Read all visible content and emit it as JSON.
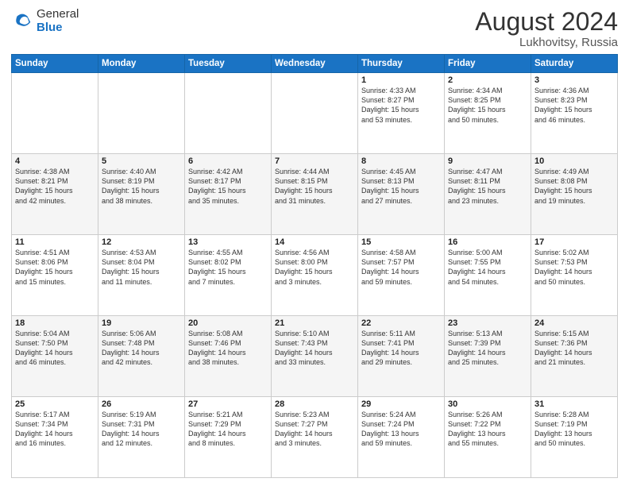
{
  "header": {
    "logo_general": "General",
    "logo_blue": "Blue",
    "month_title": "August 2024",
    "location": "Lukhovitsy, Russia"
  },
  "days_of_week": [
    "Sunday",
    "Monday",
    "Tuesday",
    "Wednesday",
    "Thursday",
    "Friday",
    "Saturday"
  ],
  "weeks": [
    [
      {
        "day": "",
        "detail": ""
      },
      {
        "day": "",
        "detail": ""
      },
      {
        "day": "",
        "detail": ""
      },
      {
        "day": "",
        "detail": ""
      },
      {
        "day": "1",
        "detail": "Sunrise: 4:33 AM\nSunset: 8:27 PM\nDaylight: 15 hours\nand 53 minutes."
      },
      {
        "day": "2",
        "detail": "Sunrise: 4:34 AM\nSunset: 8:25 PM\nDaylight: 15 hours\nand 50 minutes."
      },
      {
        "day": "3",
        "detail": "Sunrise: 4:36 AM\nSunset: 8:23 PM\nDaylight: 15 hours\nand 46 minutes."
      }
    ],
    [
      {
        "day": "4",
        "detail": "Sunrise: 4:38 AM\nSunset: 8:21 PM\nDaylight: 15 hours\nand 42 minutes."
      },
      {
        "day": "5",
        "detail": "Sunrise: 4:40 AM\nSunset: 8:19 PM\nDaylight: 15 hours\nand 38 minutes."
      },
      {
        "day": "6",
        "detail": "Sunrise: 4:42 AM\nSunset: 8:17 PM\nDaylight: 15 hours\nand 35 minutes."
      },
      {
        "day": "7",
        "detail": "Sunrise: 4:44 AM\nSunset: 8:15 PM\nDaylight: 15 hours\nand 31 minutes."
      },
      {
        "day": "8",
        "detail": "Sunrise: 4:45 AM\nSunset: 8:13 PM\nDaylight: 15 hours\nand 27 minutes."
      },
      {
        "day": "9",
        "detail": "Sunrise: 4:47 AM\nSunset: 8:11 PM\nDaylight: 15 hours\nand 23 minutes."
      },
      {
        "day": "10",
        "detail": "Sunrise: 4:49 AM\nSunset: 8:08 PM\nDaylight: 15 hours\nand 19 minutes."
      }
    ],
    [
      {
        "day": "11",
        "detail": "Sunrise: 4:51 AM\nSunset: 8:06 PM\nDaylight: 15 hours\nand 15 minutes."
      },
      {
        "day": "12",
        "detail": "Sunrise: 4:53 AM\nSunset: 8:04 PM\nDaylight: 15 hours\nand 11 minutes."
      },
      {
        "day": "13",
        "detail": "Sunrise: 4:55 AM\nSunset: 8:02 PM\nDaylight: 15 hours\nand 7 minutes."
      },
      {
        "day": "14",
        "detail": "Sunrise: 4:56 AM\nSunset: 8:00 PM\nDaylight: 15 hours\nand 3 minutes."
      },
      {
        "day": "15",
        "detail": "Sunrise: 4:58 AM\nSunset: 7:57 PM\nDaylight: 14 hours\nand 59 minutes."
      },
      {
        "day": "16",
        "detail": "Sunrise: 5:00 AM\nSunset: 7:55 PM\nDaylight: 14 hours\nand 54 minutes."
      },
      {
        "day": "17",
        "detail": "Sunrise: 5:02 AM\nSunset: 7:53 PM\nDaylight: 14 hours\nand 50 minutes."
      }
    ],
    [
      {
        "day": "18",
        "detail": "Sunrise: 5:04 AM\nSunset: 7:50 PM\nDaylight: 14 hours\nand 46 minutes."
      },
      {
        "day": "19",
        "detail": "Sunrise: 5:06 AM\nSunset: 7:48 PM\nDaylight: 14 hours\nand 42 minutes."
      },
      {
        "day": "20",
        "detail": "Sunrise: 5:08 AM\nSunset: 7:46 PM\nDaylight: 14 hours\nand 38 minutes."
      },
      {
        "day": "21",
        "detail": "Sunrise: 5:10 AM\nSunset: 7:43 PM\nDaylight: 14 hours\nand 33 minutes."
      },
      {
        "day": "22",
        "detail": "Sunrise: 5:11 AM\nSunset: 7:41 PM\nDaylight: 14 hours\nand 29 minutes."
      },
      {
        "day": "23",
        "detail": "Sunrise: 5:13 AM\nSunset: 7:39 PM\nDaylight: 14 hours\nand 25 minutes."
      },
      {
        "day": "24",
        "detail": "Sunrise: 5:15 AM\nSunset: 7:36 PM\nDaylight: 14 hours\nand 21 minutes."
      }
    ],
    [
      {
        "day": "25",
        "detail": "Sunrise: 5:17 AM\nSunset: 7:34 PM\nDaylight: 14 hours\nand 16 minutes."
      },
      {
        "day": "26",
        "detail": "Sunrise: 5:19 AM\nSunset: 7:31 PM\nDaylight: 14 hours\nand 12 minutes."
      },
      {
        "day": "27",
        "detail": "Sunrise: 5:21 AM\nSunset: 7:29 PM\nDaylight: 14 hours\nand 8 minutes."
      },
      {
        "day": "28",
        "detail": "Sunrise: 5:23 AM\nSunset: 7:27 PM\nDaylight: 14 hours\nand 3 minutes."
      },
      {
        "day": "29",
        "detail": "Sunrise: 5:24 AM\nSunset: 7:24 PM\nDaylight: 13 hours\nand 59 minutes."
      },
      {
        "day": "30",
        "detail": "Sunrise: 5:26 AM\nSunset: 7:22 PM\nDaylight: 13 hours\nand 55 minutes."
      },
      {
        "day": "31",
        "detail": "Sunrise: 5:28 AM\nSunset: 7:19 PM\nDaylight: 13 hours\nand 50 minutes."
      }
    ]
  ]
}
